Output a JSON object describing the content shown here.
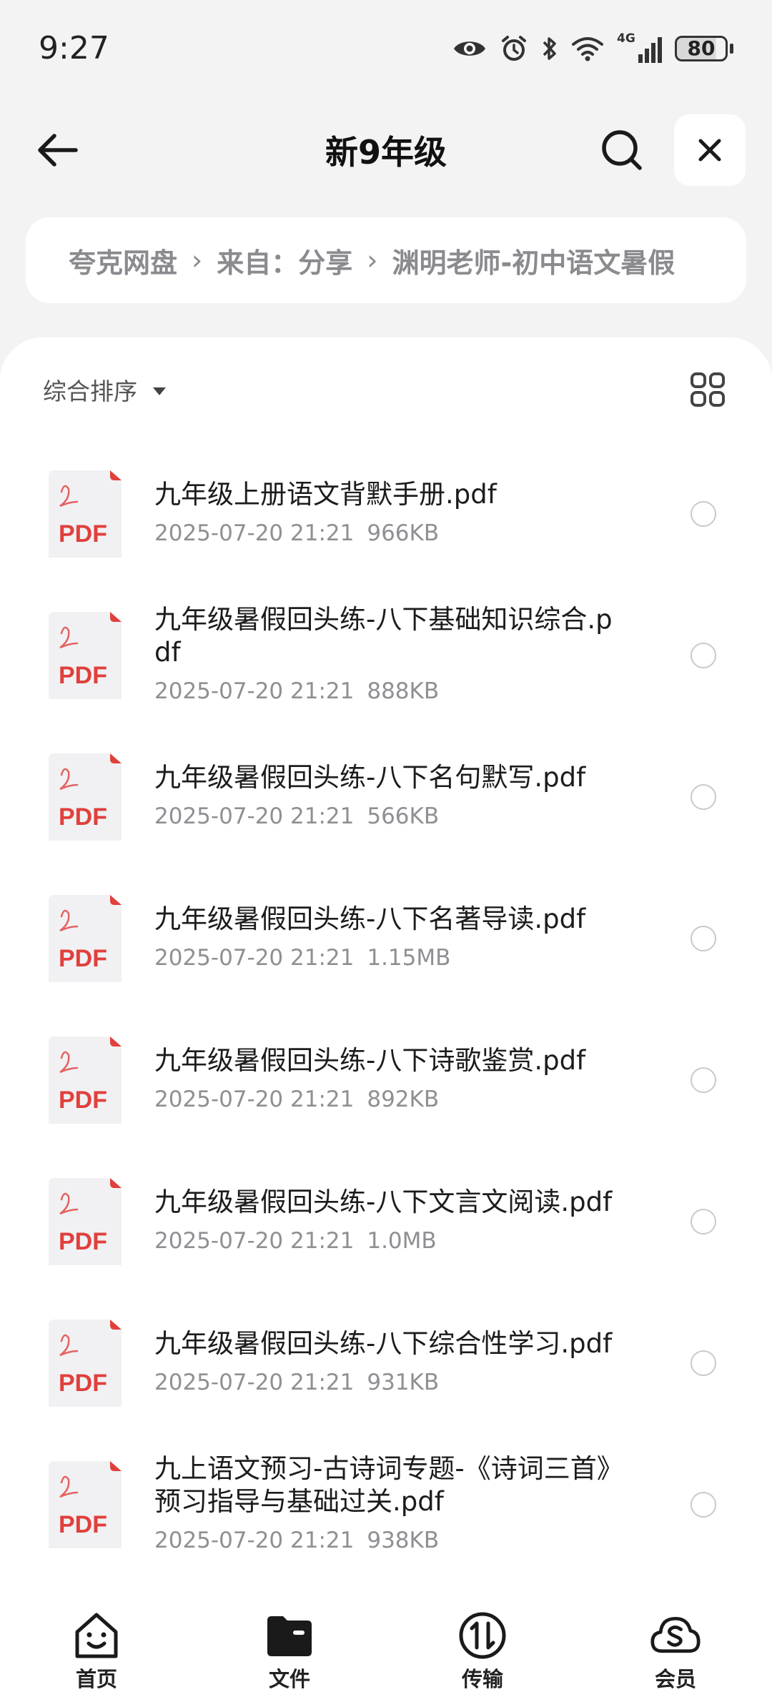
{
  "status_bar": {
    "time": "9:27",
    "network": "4G",
    "battery": "80"
  },
  "header": {
    "title": "新9年级"
  },
  "breadcrumb": {
    "items": [
      "夸克网盘",
      "来自：分享",
      "渊明老师-初中语文暑假"
    ],
    "separator": "›"
  },
  "toolbar": {
    "sort_label": "综合排序"
  },
  "files": [
    {
      "name": "九年级上册语文背默手册.pdf",
      "date": "2025-07-20 21:21",
      "size": "966KB"
    },
    {
      "name": "九年级暑假回头练-八下基础知识综合.pdf",
      "date": "2025-07-20 21:21",
      "size": "888KB"
    },
    {
      "name": "九年级暑假回头练-八下名句默写.pdf",
      "date": "2025-07-20 21:21",
      "size": "566KB"
    },
    {
      "name": "九年级暑假回头练-八下名著导读.pdf",
      "date": "2025-07-20 21:21",
      "size": "1.15MB"
    },
    {
      "name": "九年级暑假回头练-八下诗歌鉴赏.pdf",
      "date": "2025-07-20 21:21",
      "size": "892KB"
    },
    {
      "name": "九年级暑假回头练-八下文言文阅读.pdf",
      "date": "2025-07-20 21:21",
      "size": "1.0MB"
    },
    {
      "name": "九年级暑假回头练-八下综合性学习.pdf",
      "date": "2025-07-20 21:21",
      "size": "931KB"
    },
    {
      "name": "九上语文预习-古诗词专题-《诗词三首》预习指导与基础过关.pdf",
      "date": "2025-07-20 21:21",
      "size": "938KB"
    }
  ],
  "file_icon_label": "PDF",
  "bottom_nav": [
    {
      "label": "首页",
      "icon": "smile-icon"
    },
    {
      "label": "文件",
      "icon": "folder-icon"
    },
    {
      "label": "传输",
      "icon": "transfer-icon"
    },
    {
      "label": "会员",
      "icon": "cloud-member-icon"
    }
  ],
  "colors": {
    "accent_pdf": "#e0403c",
    "background": "#f3f3f4",
    "card": "#ffffff"
  }
}
